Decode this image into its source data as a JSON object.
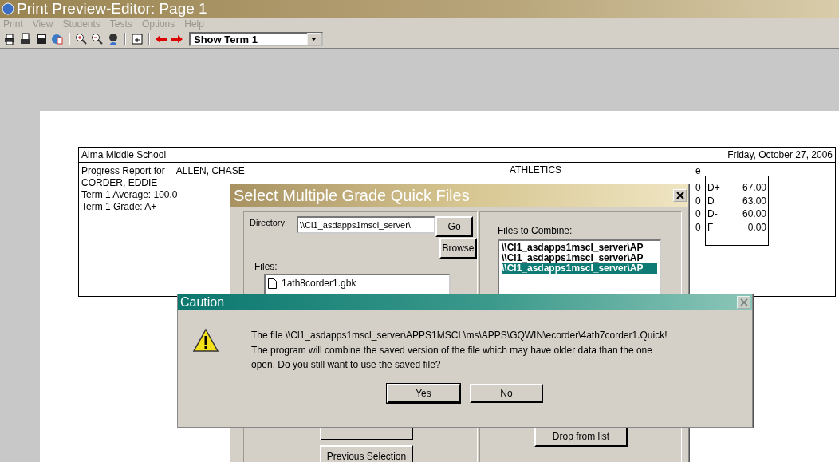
{
  "window": {
    "title": "Print Preview-Editor:  Page 1"
  },
  "menu": [
    {
      "label": "Print",
      "disabled": true
    },
    {
      "label": "View",
      "disabled": true
    },
    {
      "label": "Students",
      "disabled": true
    },
    {
      "label": "Tests",
      "disabled": true
    },
    {
      "label": "Options",
      "disabled": true
    },
    {
      "label": "Help",
      "disabled": true
    }
  ],
  "toolbar": {
    "term_select": {
      "value": "Show Term 1"
    }
  },
  "report": {
    "school": "Alma Middle School",
    "date": "Friday, October 27, 2006",
    "progress_label": "Progress Report for",
    "student": "ALLEN, CHASE",
    "lines": [
      "CORDER,  EDDIE",
      "Term 1 Average:  100.0",
      "Term 1 Grade:  A+"
    ],
    "section": "ATHLETICS",
    "grade_header": "e",
    "grade_scale": [
      {
        "cut": "0",
        "grade": "D+",
        "score": "67.00"
      },
      {
        "cut": "0",
        "grade": "D",
        "score": "63.00"
      },
      {
        "cut": "0",
        "grade": "D-",
        "score": "60.00"
      },
      {
        "cut": "0",
        "grade": "F",
        "score": "0.00"
      }
    ]
  },
  "select_dialog": {
    "title": "Select Multiple Grade Quick Files",
    "directory_label": "Directory:",
    "directory": "\\\\Cl1_asdapps1mscl_server\\",
    "go_button": "Go",
    "browse_button": "Browse",
    "files_label": "Files:",
    "files": [
      {
        "name": "1ath8corder1.gbk"
      }
    ],
    "combine_label": "Files to Combine:",
    "combine_files": [
      {
        "path": "\\\\Cl1_asdapps1mscl_server\\AP",
        "selected": false
      },
      {
        "path": "\\\\Cl1_asdapps1mscl_server\\AP",
        "selected": false
      },
      {
        "path": "\\\\Cl1_asdapps1mscl_server\\AP",
        "selected": true
      }
    ],
    "previous_button": "Previous Selection",
    "drop_button": "Drop from list"
  },
  "caution": {
    "title": "Caution",
    "message": [
      "The file \\\\Cl1_asdapps1mscl_server\\APPS1MSCL\\ms\\APPS\\GQWIN\\ecorder\\4ath7corder1.Quick!",
      "The program will combine the saved version of the file which may have older data than the one",
      "open.  Do you still want to use the saved file?"
    ],
    "buttons": [
      {
        "label": "Yes",
        "default": true
      },
      {
        "label": "No",
        "default": false
      }
    ]
  }
}
